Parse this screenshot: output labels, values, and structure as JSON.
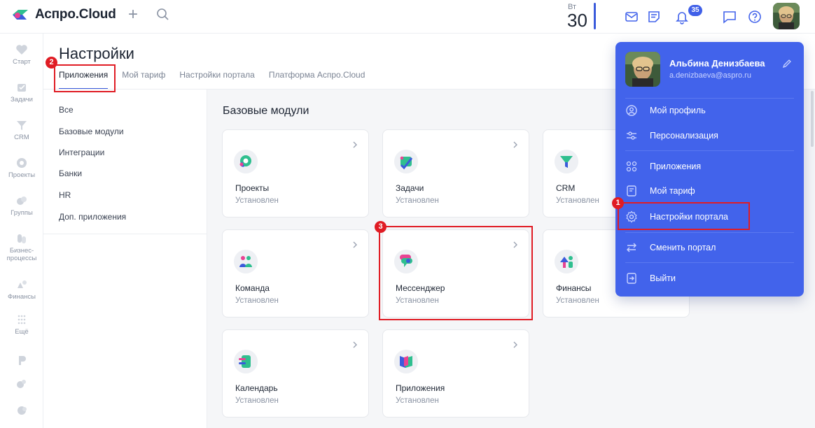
{
  "app": {
    "name": "Аспро.Cloud"
  },
  "header": {
    "date": {
      "weekday": "Вт",
      "day": "30"
    },
    "notifications_count": "35"
  },
  "nav": {
    "items": [
      {
        "label": "Старт"
      },
      {
        "label": "Задачи"
      },
      {
        "label": "CRM"
      },
      {
        "label": "Проекты"
      },
      {
        "label": "Группы"
      },
      {
        "label": "Бизнес-процессы"
      },
      {
        "label": "Финансы"
      },
      {
        "label": "Ещё"
      }
    ]
  },
  "page": {
    "title": "Настройки",
    "tabs": [
      {
        "label": "Приложения"
      },
      {
        "label": "Мой тариф"
      },
      {
        "label": "Настройки портала"
      },
      {
        "label": "Платформа Аспро.Cloud"
      }
    ],
    "categories": [
      {
        "label": "Все"
      },
      {
        "label": "Базовые модули"
      },
      {
        "label": "Интеграции"
      },
      {
        "label": "Банки"
      },
      {
        "label": "HR"
      },
      {
        "label": "Доп. приложения"
      }
    ],
    "section_title": "Базовые модули",
    "cards": [
      {
        "name": "Проекты",
        "status": "Установлен"
      },
      {
        "name": "Задачи",
        "status": "Установлен"
      },
      {
        "name": "CRM",
        "status": "Установлен"
      },
      {
        "name": "Команда",
        "status": "Установлен"
      },
      {
        "name": "Мессенджер",
        "status": "Установлен"
      },
      {
        "name": "Финансы",
        "status": "Установлен"
      },
      {
        "name": "Календарь",
        "status": "Установлен"
      },
      {
        "name": "Приложения",
        "status": "Установлен"
      }
    ]
  },
  "profile_menu": {
    "user_name": "Альбина Денизбаева",
    "user_email": "a.denizbaeva@aspro.ru",
    "items": [
      {
        "label": "Мой профиль",
        "icon": "user-circle-icon"
      },
      {
        "label": "Персонализация",
        "icon": "sliders-icon"
      },
      {
        "label": "Приложения",
        "icon": "apps-grid-icon"
      },
      {
        "label": "Мой тариф",
        "icon": "document-icon"
      },
      {
        "label": "Настройки портала",
        "icon": "gear-icon"
      },
      {
        "label": "Сменить портал",
        "icon": "swap-icon"
      },
      {
        "label": "Выйти",
        "icon": "logout-icon"
      }
    ]
  },
  "annotations": {
    "markers": [
      "1",
      "2",
      "3"
    ],
    "color": "#e01c24"
  },
  "colors": {
    "accent": "#4263eb",
    "highlight": "#e01c24"
  }
}
